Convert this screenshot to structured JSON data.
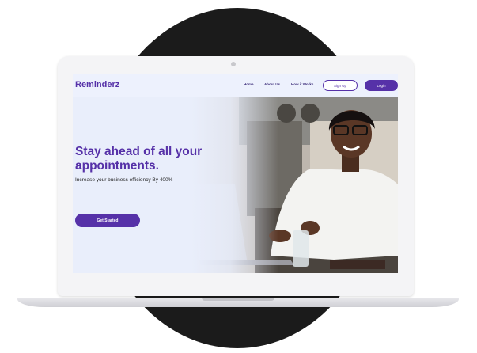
{
  "brand": {
    "name": "Reminderz",
    "accent": "#5631a8"
  },
  "nav": {
    "links": [
      "Home",
      "About Us",
      "How it Works"
    ],
    "signup_label": "Sign Up",
    "login_label": "Login"
  },
  "hero": {
    "headline": "Stay ahead of all your appointments.",
    "subtext": "Increase your business efficiency By 400%",
    "cta_label": "Get Started",
    "image": "smiling-woman-with-laptop-photo"
  }
}
